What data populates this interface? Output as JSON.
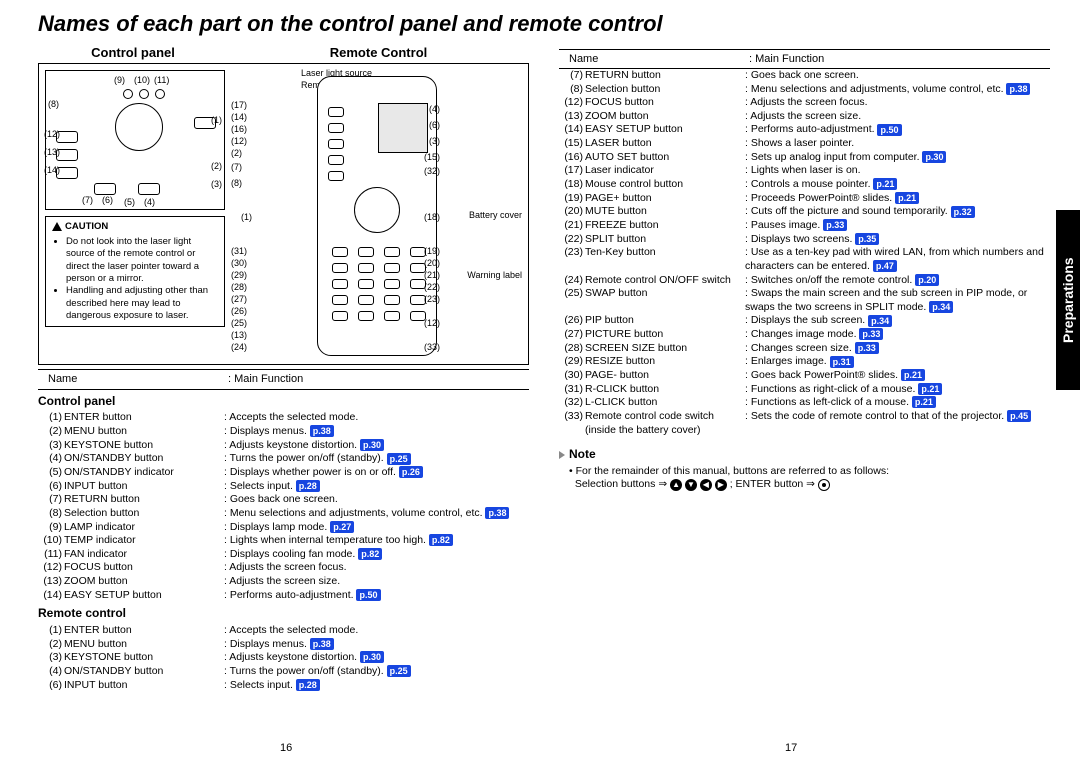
{
  "title": "Names of each part on the control panel and remote control",
  "side_tab": "Preparations",
  "diagram": {
    "left_header": "Control panel",
    "right_header": "Remote Control",
    "remote_labels": {
      "laser_source": "Laser light source",
      "transmitter": "Remote control transmitter",
      "battery_cover": "Battery cover",
      "warning_label": "Warning label"
    }
  },
  "caution": {
    "title": "CAUTION",
    "b1": "Do not look into the laser light source of the remote control or direct the laser pointer toward a person or a mirror.",
    "b2": "Handling and adjusting other than described here may lead to dangerous exposure to laser."
  },
  "table_header": {
    "name": "Name",
    "func": "Main Function"
  },
  "left": {
    "cp_title": "Control panel",
    "rc_title": "Remote control",
    "cp": [
      {
        "n": "(1)",
        "name": "ENTER button",
        "desc": "Accepts the selected mode.",
        "ref": ""
      },
      {
        "n": "(2)",
        "name": "MENU button",
        "desc": "Displays menus.",
        "ref": "p.38"
      },
      {
        "n": "(3)",
        "name": "KEYSTONE button",
        "desc": "Adjusts keystone distortion.",
        "ref": "p.30"
      },
      {
        "n": "(4)",
        "name": "ON/STANDBY button",
        "desc": "Turns the power on/off (standby).",
        "ref": "p.25"
      },
      {
        "n": "(5)",
        "name": "ON/STANDBY indicator",
        "desc": "Displays whether power is on or off.",
        "ref": "p.26"
      },
      {
        "n": "(6)",
        "name": "INPUT button",
        "desc": "Selects input.",
        "ref": "p.28"
      },
      {
        "n": "(7)",
        "name": "RETURN button",
        "desc": "Goes back one screen.",
        "ref": ""
      },
      {
        "n": "(8)",
        "name": "Selection button",
        "desc": "Menu selections and adjustments, volume control, etc.",
        "ref": "p.38"
      },
      {
        "n": "(9)",
        "name": "LAMP indicator",
        "desc": "Displays lamp mode.",
        "ref": "p.27"
      },
      {
        "n": "(10)",
        "name": "TEMP indicator",
        "desc": "Lights when internal temperature too high.",
        "ref": "p.82"
      },
      {
        "n": "(11)",
        "name": "FAN indicator",
        "desc": "Displays cooling fan mode.",
        "ref": "p.82"
      },
      {
        "n": "(12)",
        "name": "FOCUS button",
        "desc": "Adjusts the screen focus.",
        "ref": ""
      },
      {
        "n": "(13)",
        "name": "ZOOM button",
        "desc": "Adjusts the screen size.",
        "ref": ""
      },
      {
        "n": "(14)",
        "name": "EASY SETUP button",
        "desc": "Performs auto-adjustment.",
        "ref": "p.50"
      }
    ],
    "rc": [
      {
        "n": "(1)",
        "name": "ENTER button",
        "desc": "Accepts the selected mode.",
        "ref": ""
      },
      {
        "n": "(2)",
        "name": "MENU button",
        "desc": "Displays menus.",
        "ref": "p.38"
      },
      {
        "n": "(3)",
        "name": "KEYSTONE button",
        "desc": "Adjusts keystone distortion.",
        "ref": "p.30"
      },
      {
        "n": "(4)",
        "name": "ON/STANDBY button",
        "desc": "Turns the power on/off (standby).",
        "ref": "p.25"
      },
      {
        "n": "(6)",
        "name": "INPUT button",
        "desc": "Selects input.",
        "ref": "p.28"
      }
    ]
  },
  "right": {
    "rows": [
      {
        "n": "(7)",
        "name": "RETURN button",
        "desc": "Goes back one screen.",
        "ref": ""
      },
      {
        "n": "(8)",
        "name": "Selection button",
        "desc": "Menu selections and adjustments, volume control, etc.",
        "ref": "p.38"
      },
      {
        "n": "(12)",
        "name": "FOCUS button",
        "desc": "Adjusts the screen focus.",
        "ref": ""
      },
      {
        "n": "(13)",
        "name": "ZOOM button",
        "desc": "Adjusts the screen size.",
        "ref": ""
      },
      {
        "n": "(14)",
        "name": "EASY SETUP button",
        "desc": "Performs auto-adjustment.",
        "ref": "p.50"
      },
      {
        "n": "(15)",
        "name": "LASER button",
        "desc": "Shows a laser pointer.",
        "ref": ""
      },
      {
        "n": "(16)",
        "name": "AUTO SET button",
        "desc": "Sets up analog input from computer.",
        "ref": "p.30"
      },
      {
        "n": "(17)",
        "name": "Laser indicator",
        "desc": "Lights when laser is on.",
        "ref": ""
      },
      {
        "n": "(18)",
        "name": "Mouse control button",
        "desc": "Controls a mouse pointer.",
        "ref": "p.21"
      },
      {
        "n": "(19)",
        "name": "PAGE+ button",
        "desc": "Proceeds PowerPoint® slides.",
        "ref": "p.21"
      },
      {
        "n": "(20)",
        "name": "MUTE button",
        "desc": "Cuts off the picture and sound temporarily.",
        "ref": "p.32"
      },
      {
        "n": "(21)",
        "name": "FREEZE button",
        "desc": "Pauses image.",
        "ref": "p.33"
      },
      {
        "n": "(22)",
        "name": "SPLIT button",
        "desc": "Displays two screens.",
        "ref": "p.35"
      },
      {
        "n": "(23)",
        "name": "Ten-Key button",
        "desc": "Use as a ten-key pad with wired LAN, from which numbers and characters can be entered.",
        "ref": "p.47"
      },
      {
        "n": "(24)",
        "name": "Remote control ON/OFF switch",
        "desc": "Switches on/off the remote control.",
        "ref": "p.20"
      },
      {
        "n": "(25)",
        "name": "SWAP button",
        "desc": "Swaps the main screen and the sub screen in PIP mode, or swaps the two screens in SPLIT mode.",
        "ref": "p.34"
      },
      {
        "n": "(26)",
        "name": "PIP button",
        "desc": "Displays the sub screen.",
        "ref": "p.34"
      },
      {
        "n": "(27)",
        "name": "PICTURE button",
        "desc": "Changes image mode.",
        "ref": "p.33"
      },
      {
        "n": "(28)",
        "name": "SCREEN SIZE button",
        "desc": "Changes screen size.",
        "ref": "p.33"
      },
      {
        "n": "(29)",
        "name": "RESIZE button",
        "desc": "Enlarges image.",
        "ref": "p.31"
      },
      {
        "n": "(30)",
        "name": "PAGE- button",
        "desc": "Goes back PowerPoint® slides.",
        "ref": "p.21"
      },
      {
        "n": "(31)",
        "name": "R-CLICK button",
        "desc": "Functions as right-click of a mouse.",
        "ref": "p.21"
      },
      {
        "n": "(32)",
        "name": "L-CLICK button",
        "desc": "Functions as left-click of a mouse.",
        "ref": "p.21"
      },
      {
        "n": "(33)",
        "name": "Remote control code switch (inside the battery cover)",
        "desc": "Sets the code of remote control to that of the projector.",
        "ref": "p.45"
      }
    ]
  },
  "note": {
    "title": "Note",
    "line1": "For the remainder of this manual, buttons are referred to as follows:",
    "line2a": "Selection buttons ⇒ ",
    "line2b": "; ENTER button ⇒ "
  },
  "pages": {
    "left": "16",
    "right": "17"
  }
}
